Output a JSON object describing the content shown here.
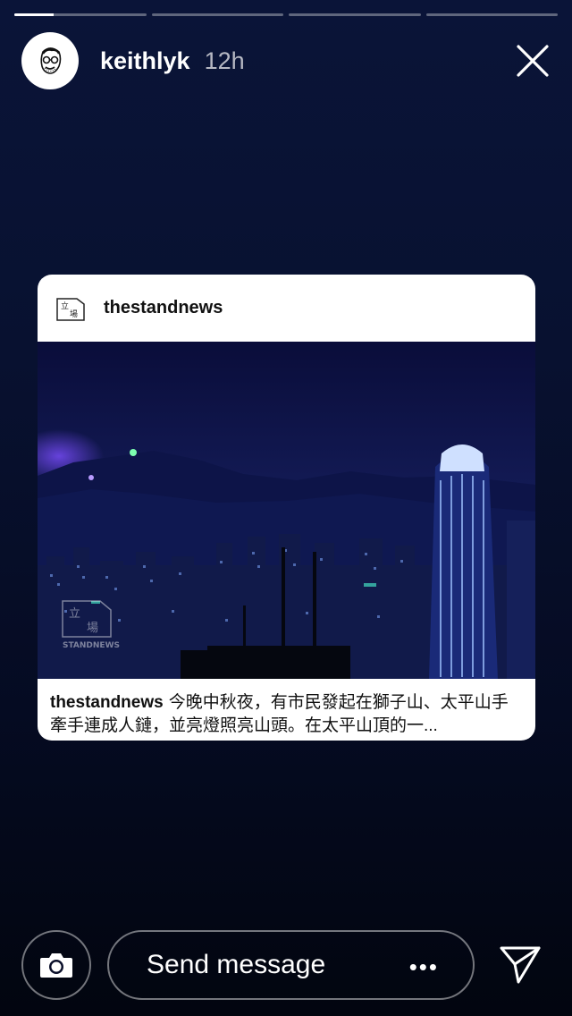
{
  "story": {
    "progress_segments": [
      {
        "fill": 0.3
      },
      {
        "fill": 0
      },
      {
        "fill": 0
      },
      {
        "fill": 0
      }
    ]
  },
  "header": {
    "username": "keithlyk",
    "time": "12h",
    "avatar_icon": "face-sketch-icon",
    "close_icon": "close-icon"
  },
  "post": {
    "username": "thestandnews",
    "logo_icon": "stand-news-logo-icon",
    "image_description_icon": "night-city-photo",
    "watermark_text": "STANDNEWS",
    "caption_user": "thestandnews",
    "caption_text": "今晚中秋夜，有市民發起在獅子山、太平山手牽手連成人鏈，並亮燈照亮山頭。在太平山頂的一..."
  },
  "footer": {
    "camera_icon": "camera-icon",
    "message_placeholder": "Send message",
    "more_icon": "more-dots-icon",
    "more_text": "•••",
    "send_icon": "send-icon"
  }
}
